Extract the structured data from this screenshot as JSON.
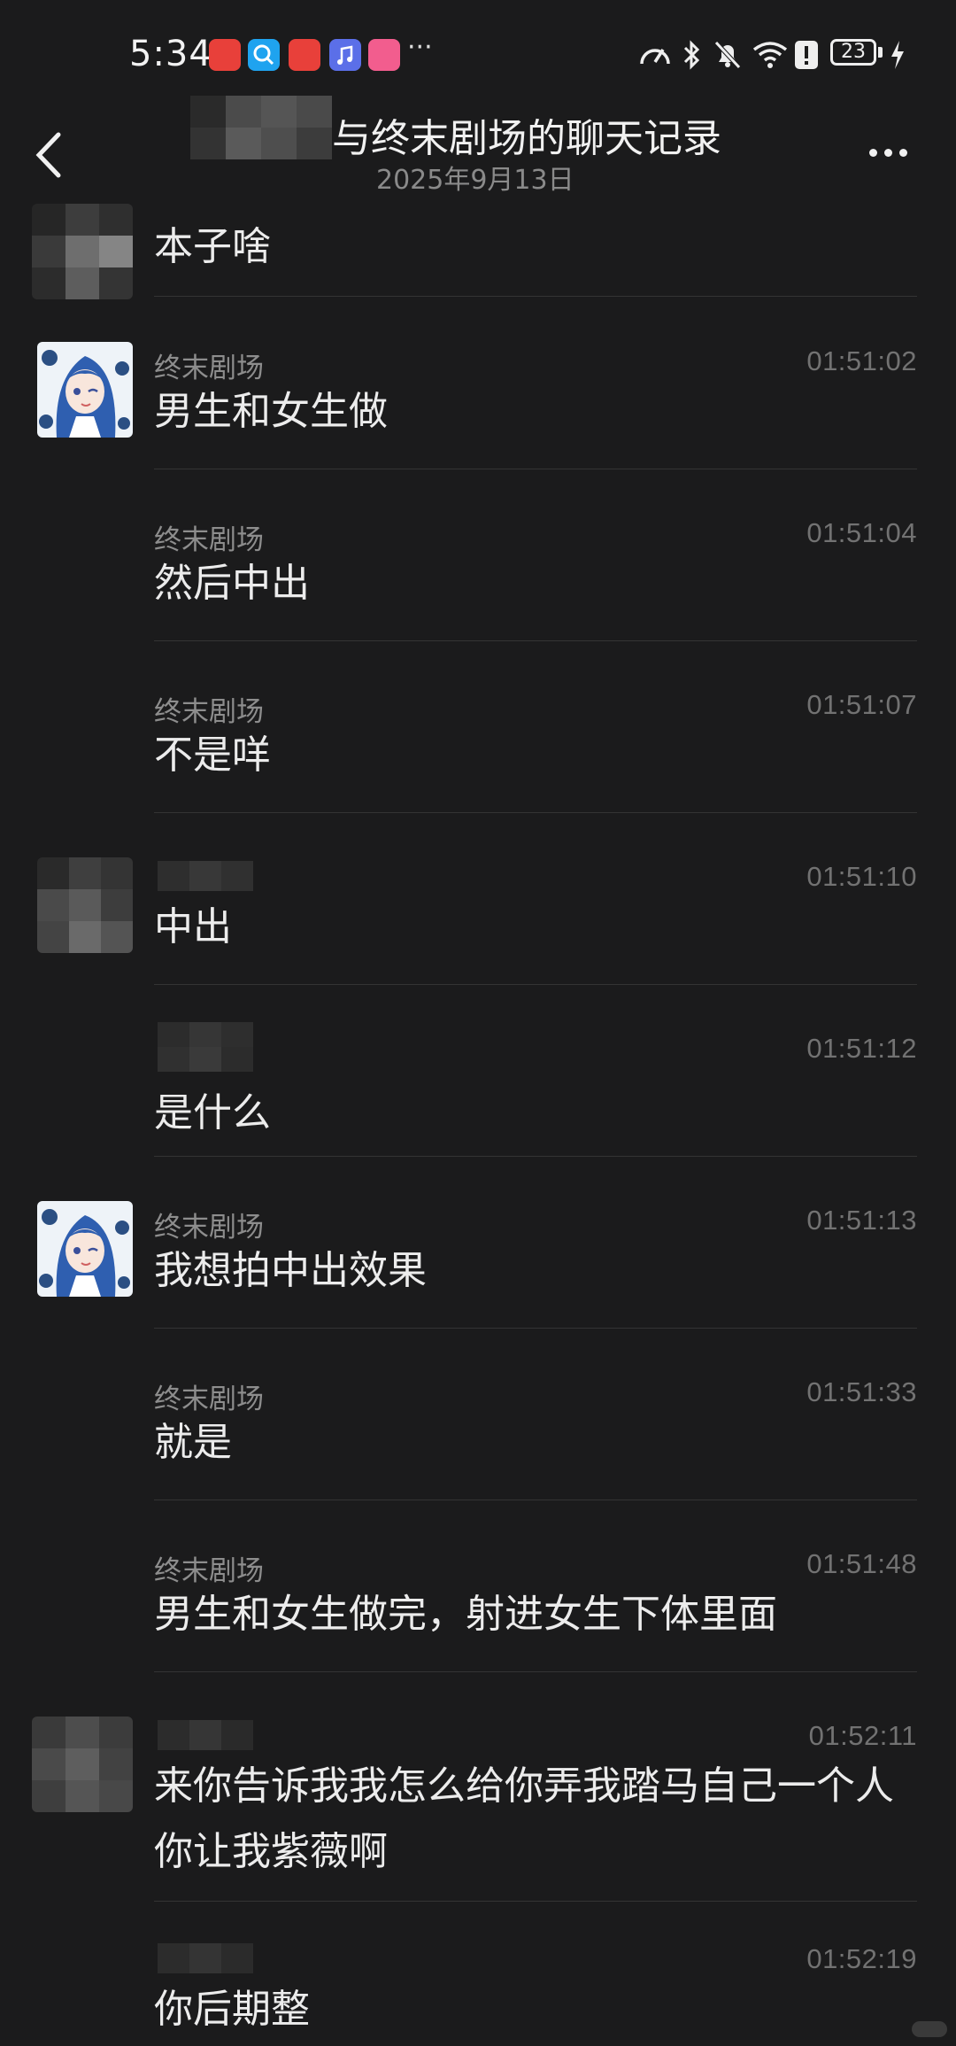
{
  "status_bar": {
    "time": "5:34",
    "battery": "23",
    "app_icons": [
      "huawei-appgallery-icon",
      "search-app-icon",
      "huawei-appgallery-icon",
      "music-app-icon",
      "bilibili-icon"
    ],
    "overflow": "···"
  },
  "header": {
    "title": "与终末剧场的聊天记录",
    "date": "2025年9月13日"
  },
  "messages": [
    {
      "sender": "",
      "time": "",
      "text": "本子啥"
    },
    {
      "sender": "终末剧场",
      "time": "01:51:02",
      "text": "男生和女生做"
    },
    {
      "sender": "终末剧场",
      "time": "01:51:04",
      "text": "然后中出"
    },
    {
      "sender": "终末剧场",
      "time": "01:51:07",
      "text": "不是咩"
    },
    {
      "sender": "",
      "time": "01:51:10",
      "text": "中出"
    },
    {
      "sender": "",
      "time": "01:51:12",
      "text": "是什么"
    },
    {
      "sender": "终末剧场",
      "time": "01:51:13",
      "text": "我想拍中出效果"
    },
    {
      "sender": "终末剧场",
      "time": "01:51:33",
      "text": "就是"
    },
    {
      "sender": "终末剧场",
      "time": "01:51:48",
      "text": "男生和女生做完，射进女生下体里面"
    },
    {
      "sender": "",
      "time": "01:52:11",
      "text": "来你告诉我我怎么给你弄我踏马自己一个人你让我紫薇啊"
    },
    {
      "sender": "",
      "time": "01:52:19",
      "text": "你后期整"
    }
  ],
  "colors": {
    "background": "#1b1b1c",
    "text": "#ececec",
    "sender": "#8d8d8d",
    "time": "#727272",
    "divider": "#343434"
  }
}
